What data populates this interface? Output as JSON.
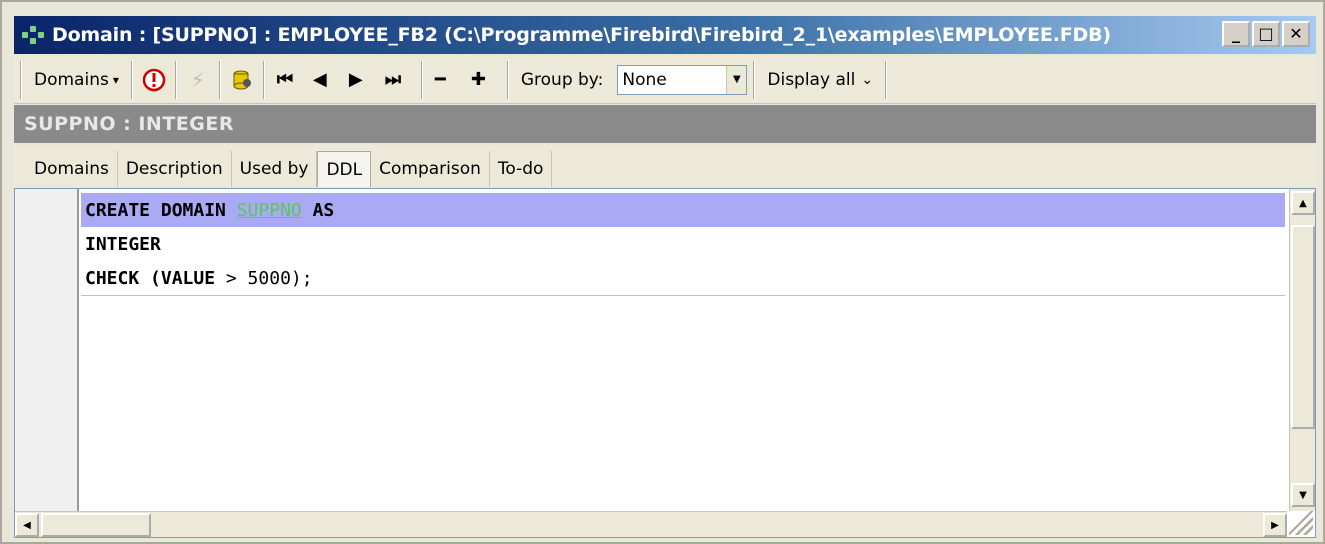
{
  "window": {
    "title": "Domain : [SUPPNO] : EMPLOYEE_FB2 (C:\\Programme\\Firebird\\Firebird_2_1\\examples\\EMPLOYEE.FDB)",
    "minimize": "_",
    "maximize": "□",
    "close": "✕"
  },
  "toolbar": {
    "domains_label": "Domains",
    "domains_caret": "▾",
    "group_by_label": "Group by:",
    "group_by_value": "None",
    "display_all_label": "Display all",
    "display_all_caret": "⌄",
    "nav_first": "⏮",
    "nav_prev": "◀",
    "nav_next": "▶",
    "nav_last": "⏭",
    "minus": "━",
    "plus": "✚"
  },
  "header": {
    "text": "SUPPNO : INTEGER"
  },
  "tabs": [
    "Domains",
    "Description",
    "Used by",
    "DDL",
    "Comparison",
    "To-do"
  ],
  "active_tab": "DDL",
  "editor": {
    "line1_kw1": "CREATE DOMAIN ",
    "line1_ident": "SUPPNO",
    "line1_kw2": " AS",
    "line2": "INTEGER",
    "line3_kw": "CHECK (VALUE",
    "line3_rest": " > 5000);"
  },
  "colors": {
    "highlight": "#a9a9f4",
    "identifier": "#5ac85a",
    "header_bg": "#8a8a8a"
  }
}
